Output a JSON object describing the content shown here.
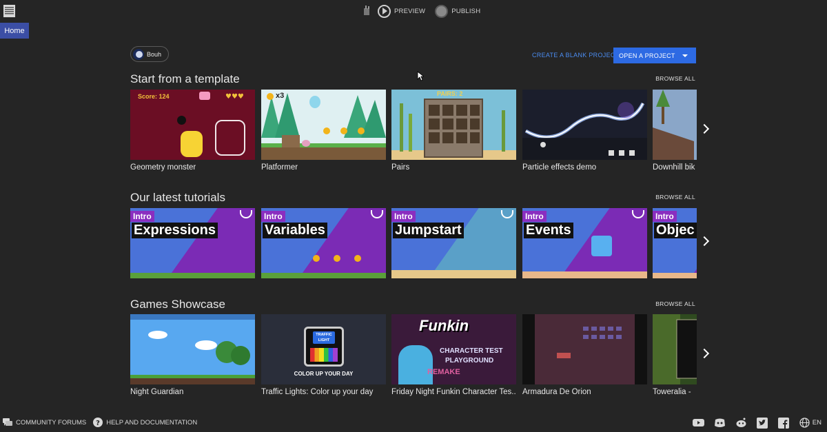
{
  "app": {
    "home_tab": "Home"
  },
  "toolbar": {
    "preview_label": "PREVIEW",
    "publish_label": "PUBLISH"
  },
  "user": {
    "name": "Bouh"
  },
  "actions": {
    "create_blank_label": "CREATE A BLANK PROJECT",
    "open_project_label": "OPEN A PROJECT"
  },
  "sections": [
    {
      "title": "Start from a template",
      "browse_label": "BROWSE ALL",
      "cards": [
        {
          "title": "Geometry monster"
        },
        {
          "title": "Platformer"
        },
        {
          "title": "Pairs"
        },
        {
          "title": "Particle effects demo"
        },
        {
          "title": "Downhill bik"
        }
      ]
    },
    {
      "title": "Our latest tutorials",
      "browse_label": "BROWSE ALL",
      "cards": [
        {
          "title": "",
          "intro": "Intro",
          "big": "Expressions"
        },
        {
          "title": "",
          "intro": "Intro",
          "big": "Variables"
        },
        {
          "title": "",
          "intro": "Intro",
          "big": "Jumpstart"
        },
        {
          "title": "",
          "intro": "Intro",
          "big": "Events"
        },
        {
          "title": "",
          "intro": "Intro",
          "big": "Objec"
        }
      ]
    },
    {
      "title": "Games Showcase",
      "browse_label": "BROWSE ALL",
      "cards": [
        {
          "title": "Night Guardian"
        },
        {
          "title": "Traffic Lights: Color up your day"
        },
        {
          "title": "Friday Night Funkin Character Tes..."
        },
        {
          "title": "Armadura De Orion"
        },
        {
          "title": "Toweralia -"
        }
      ]
    }
  ],
  "thumb_text": {
    "geo_score": "Score: 124",
    "plat_lives": "x3",
    "pairs_title": "PAIRS: 2",
    "tl_sign_1": "TRAFFIC",
    "tl_sign_2": "LIGHT",
    "tl_caption": "COLOR UP YOUR DAY",
    "fnf_1": "Funkin",
    "fnf_2": "CHARACTER TEST",
    "fnf_3": "PLAYGROUND",
    "fnf_4": "REMAKE"
  },
  "footer": {
    "forums_label": "COMMUNITY FORUMS",
    "help_label": "HELP AND DOCUMENTATION",
    "language": "EN"
  },
  "colors": {
    "background": "#252525",
    "accent_blue": "#2d6ae3",
    "link_blue": "#4b8cf0",
    "home_tab": "#3b4ea5"
  }
}
